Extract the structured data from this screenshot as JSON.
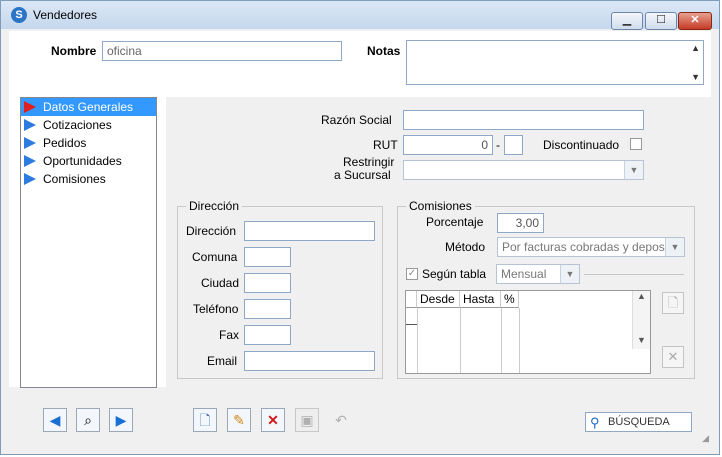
{
  "window": {
    "title": "Vendedores",
    "icon": "s-logo-icon",
    "buttons": {
      "minimize": "▁",
      "maximize": "☐",
      "close": "✕"
    }
  },
  "header": {
    "nombre_label": "Nombre",
    "nombre_value": "oficina",
    "notas_label": "Notas"
  },
  "nav": {
    "items": [
      {
        "label": "Datos Generales",
        "selected": true
      },
      {
        "label": "Cotizaciones"
      },
      {
        "label": "Pedidos"
      },
      {
        "label": "Oportunidades"
      },
      {
        "label": "Comisiones"
      }
    ]
  },
  "general": {
    "razon_social_label": "Razón Social",
    "razon_social_value": "",
    "rut_label": "RUT",
    "rut_value": "0",
    "rut_dash": "-",
    "rut_dv": "",
    "discontinuado_label": "Discontinuado",
    "restringir_label_1": "Restringir",
    "restringir_label_2": "a Sucursal",
    "restringir_value": ""
  },
  "direccion": {
    "legend": "Dirección",
    "fields": {
      "direccion": "Dirección",
      "comuna": "Comuna",
      "ciudad": "Ciudad",
      "telefono": "Teléfono",
      "fax": "Fax",
      "email": "Email"
    }
  },
  "comisiones": {
    "legend": "Comisiones",
    "porcentaje_label": "Porcentaje",
    "porcentaje_value": "3,00",
    "metodo_label": "Método",
    "metodo_value": "Por facturas cobradas y depos",
    "segun_tabla_label": "Según tabla",
    "segun_tabla_checked": true,
    "periodo_value": "Mensual",
    "table_headers": [
      "Desde",
      "Hasta",
      "%"
    ]
  },
  "toolbar": {
    "search_label": "BÚSQUEDA"
  }
}
